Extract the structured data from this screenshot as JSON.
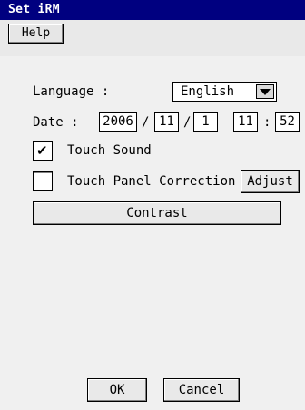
{
  "window": {
    "title": "Set iRM"
  },
  "menu": {
    "help_label": "Help"
  },
  "language": {
    "label": "Language :",
    "selected": "English",
    "arrow_icon": "dropdown-arrow-icon"
  },
  "date": {
    "label": "Date :",
    "year": "2006",
    "sep1": "/",
    "month": "11",
    "sep2": "/",
    "day": "1",
    "hour": "11",
    "time_sep": ":",
    "minute": "52"
  },
  "touch_sound": {
    "label": "Touch Sound",
    "checked": true,
    "check_mark": "✔"
  },
  "touch_panel": {
    "label": "Touch Panel Correction",
    "checked": false,
    "adjust_label": "Adjust"
  },
  "contrast": {
    "label": "Contrast"
  },
  "footer": {
    "ok_label": "OK",
    "cancel_label": "Cancel"
  }
}
